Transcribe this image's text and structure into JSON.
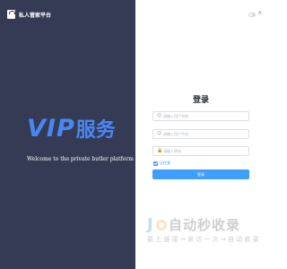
{
  "brand": {
    "name": "私人管家平台",
    "logo_icon": "brand-logo-icon"
  },
  "hero": {
    "vip": "VIP",
    "service": "服务",
    "welcome": "Welcome to the private butler platform",
    "accent_color": "#4a86f2"
  },
  "header": {
    "lang_label": "A",
    "theme_toggle_icon": "toggle-icon"
  },
  "login": {
    "title": "登录",
    "username_placeholder": "请输入用户名称",
    "phone_placeholder": "请输入用户手机",
    "password_placeholder": "请输入密码",
    "remember_label": "记住我",
    "submit_label": "登录",
    "primary_color": "#409eff"
  },
  "watermark": {
    "title": "自动秒收录",
    "subtitle": "载 上 链 接 → 来 访 一 次 → 自 动 收 录"
  }
}
